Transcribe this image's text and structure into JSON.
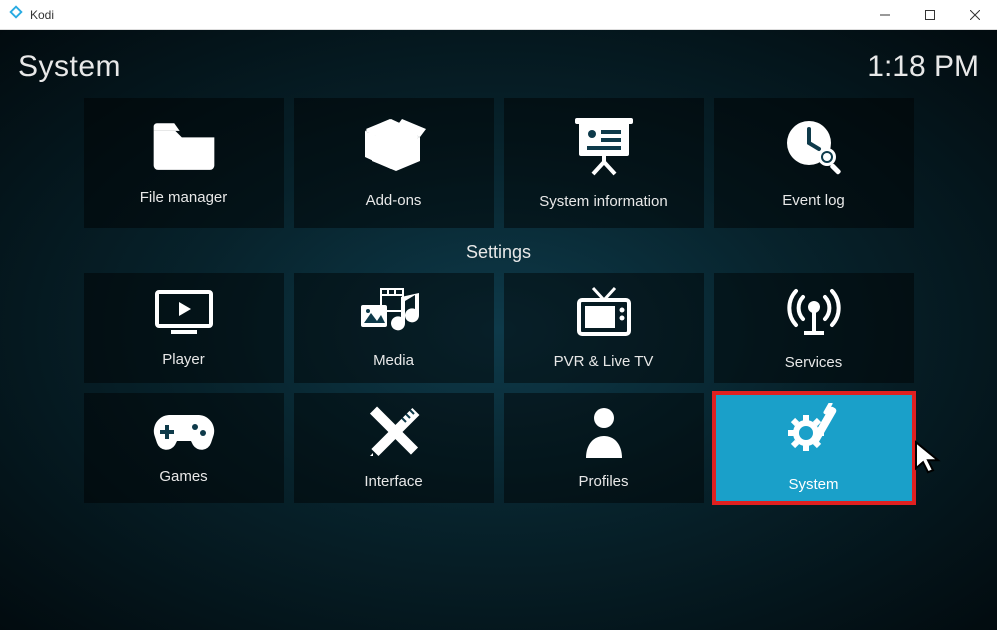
{
  "window": {
    "app_title": "Kodi",
    "controls": {
      "min": "minimize",
      "max": "maximize",
      "close": "close"
    }
  },
  "header": {
    "page_title": "System",
    "clock": "1:18 PM"
  },
  "top_tiles": [
    {
      "icon": "folder-icon",
      "label": "File manager"
    },
    {
      "icon": "open-box-icon",
      "label": "Add-ons"
    },
    {
      "icon": "presentation-icon",
      "label": "System information"
    },
    {
      "icon": "clock-search-icon",
      "label": "Event log"
    }
  ],
  "section_label": "Settings",
  "settings_tiles_r1": [
    {
      "icon": "play-monitor-icon",
      "label": "Player"
    },
    {
      "icon": "media-icon",
      "label": "Media"
    },
    {
      "icon": "tv-icon",
      "label": "PVR & Live TV"
    },
    {
      "icon": "broadcast-icon",
      "label": "Services"
    }
  ],
  "settings_tiles_r2": [
    {
      "icon": "gamepad-icon",
      "label": "Games"
    },
    {
      "icon": "pencil-ruler-icon",
      "label": "Interface"
    },
    {
      "icon": "person-icon",
      "label": "Profiles"
    },
    {
      "icon": "gear-tool-icon",
      "label": "System",
      "selected": true
    }
  ]
}
